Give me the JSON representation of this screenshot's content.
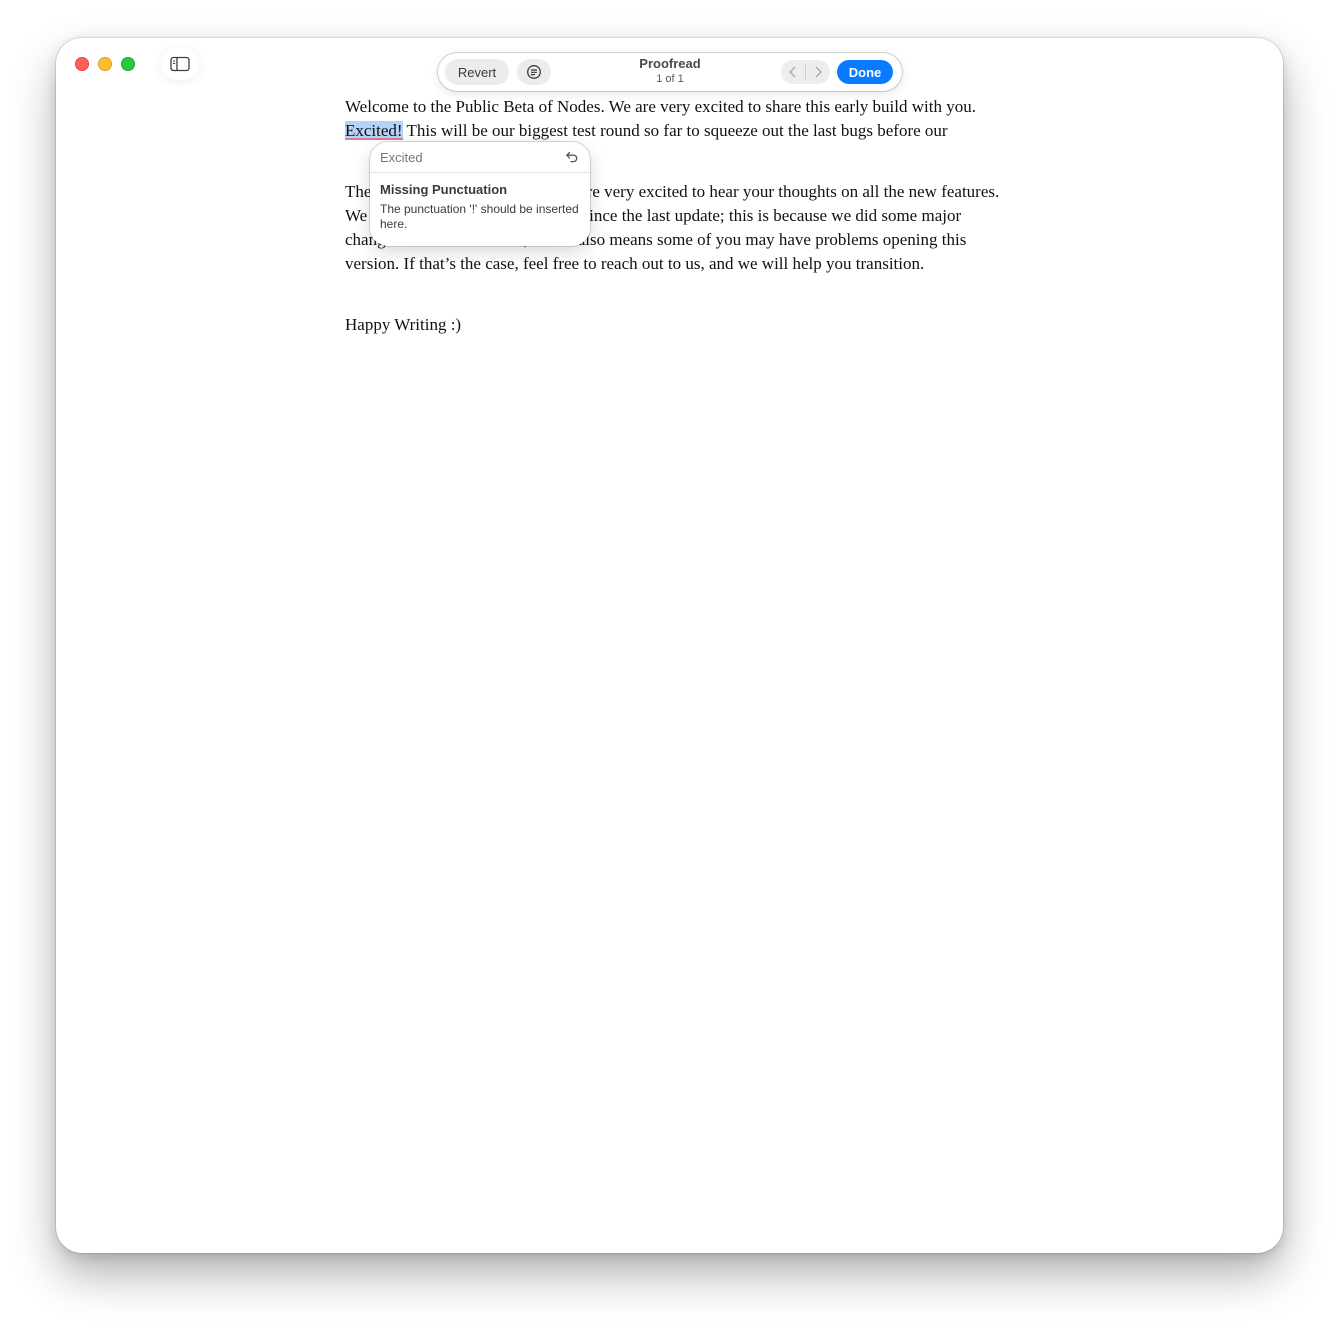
{
  "window": {
    "controls": {
      "close": "close-icon",
      "minimize": "minimize-icon",
      "maximize": "maximize-icon"
    },
    "sidebar_toggle_icon": "sidebar-icon"
  },
  "toolbar": {
    "revert_label": "Revert",
    "style_icon": "text-style-icon",
    "title": "Proofread",
    "counter": "1 of 1",
    "prev_icon": "chevron-left-icon",
    "next_icon": "chevron-right-icon",
    "done_label": "Done"
  },
  "document": {
    "para1_before": "Welcome to the Public Beta of Nodes. We are very excited to share this early build with you. ",
    "highlighted_word": "Excited!",
    "para1_after": " This will be our biggest test round so far to squeeze out the last bugs before our",
    "para2_start": "The",
    "para2_rest": ", and we’re very excited to hear your thoughts on all the new features. We know it has been quite a while since the last update; this is because we did some major changes to our data model, which also means some of you may have problems opening this version. If that’s the case, feel free to reach out to us, and we will help you transition.",
    "closing": "Happy Writing :)"
  },
  "suggestion": {
    "original_word": "Excited",
    "undo_icon": "undo-arrow-icon",
    "title": "Missing Punctuation",
    "description": "The punctuation '!' should be inserted here."
  },
  "colors": {
    "accent": "#0a7aff",
    "highlight": "#b3d4f7",
    "close": "#ff5f57",
    "minimize": "#febc2e",
    "maximize": "#28c840"
  }
}
